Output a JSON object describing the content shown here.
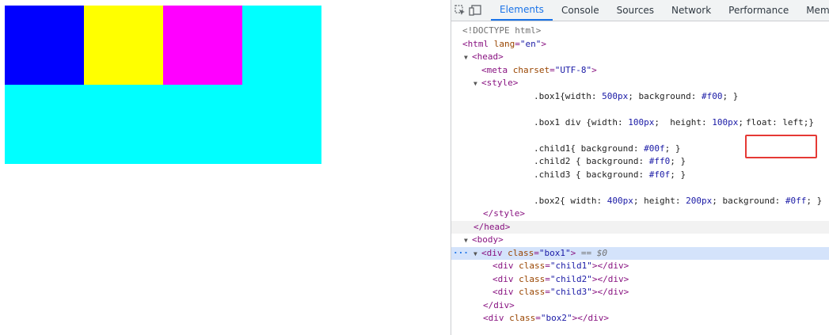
{
  "page": {
    "colors": {
      "child1": "#0000ff",
      "child2": "#ffff00",
      "child3": "#ff00ff",
      "box2": "#00ffff"
    }
  },
  "devtools": {
    "icons": [
      "inspect-element-icon",
      "device-toolbar-icon"
    ],
    "tabs": [
      "Elements",
      "Console",
      "Sources",
      "Network",
      "Performance",
      "Memo"
    ],
    "active_tab": "Elements",
    "doctype": "<!DOCTYPE html>",
    "html_open": "html",
    "html_lang_attr": "lang",
    "html_lang_val": "\"en\"",
    "head_tag": "head",
    "meta_tag": "meta",
    "meta_attr": "charset",
    "meta_val": "\"UTF-8\"",
    "style_tag": "style",
    "css": {
      "box1_sel": ".box1{",
      "box1_w_prop": "width: ",
      "box1_w_val": "500px",
      "box1_bg_prop": "; background: ",
      "box1_bg_val": "#f00",
      "box1_end": "; }",
      "boxdiv_sel": ".box1 div {",
      "boxdiv_w_prop": "width: ",
      "boxdiv_w_val": "100px",
      "boxdiv_h_prop": ";  height: ",
      "boxdiv_h_val": "100px",
      "boxdiv_sc": ";",
      "boxdiv_float": "float: left;}",
      "child1_sel": ".child1{ background: ",
      "child1_val": "#00f",
      "child1_end": "; }",
      "child2_sel": ".child2 { background: ",
      "child2_val": "#ff0",
      "child2_end": "; }",
      "child3_sel": ".child3 { background: ",
      "child3_val": "#f0f",
      "child3_end": "; }",
      "box2_sel": ".box2{ width: ",
      "box2_w_val": "400px",
      "box2_h_prop": "; height: ",
      "box2_h_val": "200px",
      "box2_bg_prop": "; background: ",
      "box2_bg_val": "#0ff",
      "box2_end": "; }"
    },
    "style_close": "</style>",
    "head_close": "</head>",
    "body_tag": "body",
    "box1_div": "div",
    "class_attr": "class",
    "box1_class": "\"box1\"",
    "selected_marker": " == $0",
    "ellipsis": "···",
    "child1_class": "\"child1\"",
    "child2_class": "\"child2\"",
    "child3_class": "\"child3\"",
    "box2_class": "\"box2\"",
    "div_close": "</div>"
  }
}
